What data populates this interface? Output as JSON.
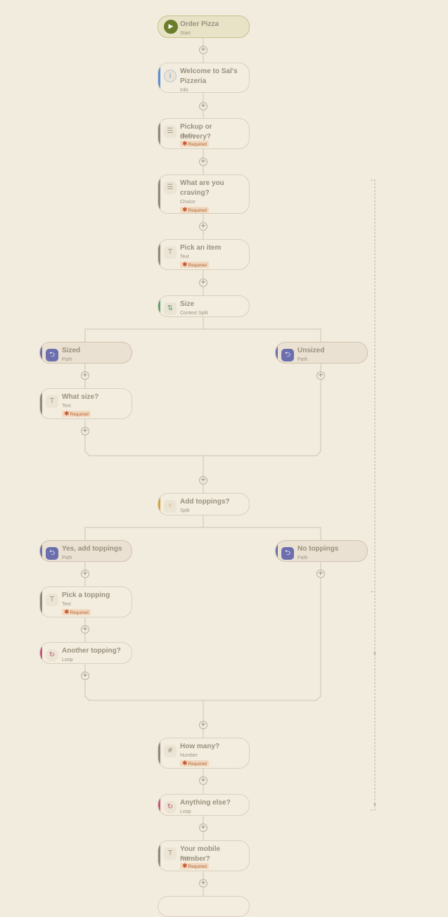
{
  "required_label": "Required",
  "colors": {
    "background": "#f2ecde",
    "line": "#cbc3b3",
    "loop_line": "#bdb5a5",
    "start": "#6b7d2a",
    "info": "#5b8ed6",
    "choice": "#8a8a80",
    "context_split": "#5aa06a",
    "path": "#6c6fae",
    "split": "#d1a23a",
    "loop": "#c2557a",
    "required_bg": "#f1d9c0",
    "required_text": "#b5653a"
  },
  "nodes": [
    {
      "id": "order-pizza",
      "title": "Order Pizza",
      "type": "Start",
      "kind": "start",
      "icon": "play-icon",
      "required": false
    },
    {
      "id": "welcome",
      "title": "Welcome to Sal's Pizzeria",
      "type": "Info",
      "kind": "info",
      "icon": "info-icon",
      "required": false
    },
    {
      "id": "pickup",
      "title": "Pickup or delivery?",
      "type": "Choice",
      "kind": "choice",
      "icon": "list-icon",
      "required": true
    },
    {
      "id": "craving",
      "title": "What are you craving?",
      "type": "Choice",
      "kind": "choice",
      "icon": "list-icon",
      "required": true
    },
    {
      "id": "pick-item",
      "title": "Pick an item",
      "type": "Text",
      "kind": "text",
      "icon": "text-icon",
      "required": true
    },
    {
      "id": "size",
      "title": "Size",
      "type": "Context Split",
      "kind": "context-split",
      "icon": "split-arrows-icon",
      "required": false
    },
    {
      "id": "sized",
      "title": "Sized",
      "type": "Path",
      "kind": "path",
      "icon": "signpost-icon",
      "required": false
    },
    {
      "id": "unsized",
      "title": "Unsized",
      "type": "Path",
      "kind": "path",
      "icon": "signpost-icon",
      "required": false
    },
    {
      "id": "what-size",
      "title": "What size?",
      "type": "Text",
      "kind": "text",
      "icon": "text-icon",
      "required": true
    },
    {
      "id": "add-toppings",
      "title": "Add toppings?",
      "type": "Split",
      "kind": "split",
      "icon": "fork-icon",
      "required": false
    },
    {
      "id": "yes-toppings",
      "title": "Yes, add toppings",
      "type": "Path",
      "kind": "path",
      "icon": "signpost-icon",
      "required": false
    },
    {
      "id": "no-toppings",
      "title": "No toppings",
      "type": "Path",
      "kind": "path",
      "icon": "signpost-icon",
      "required": false
    },
    {
      "id": "pick-topping",
      "title": "Pick a topping",
      "type": "Text",
      "kind": "text",
      "icon": "text-icon",
      "required": true
    },
    {
      "id": "another-topping",
      "title": "Another topping?",
      "type": "Loop",
      "kind": "loop",
      "icon": "loop-icon",
      "required": false
    },
    {
      "id": "how-many",
      "title": "How many?",
      "type": "Number",
      "kind": "number",
      "icon": "hash-icon",
      "required": true
    },
    {
      "id": "anything-else",
      "title": "Anything else?",
      "type": "Loop",
      "kind": "loop",
      "icon": "loop-icon",
      "required": false
    },
    {
      "id": "mobile",
      "title": "Your mobile number?",
      "type": "Text",
      "kind": "text",
      "icon": "text-icon",
      "required": true
    }
  ]
}
